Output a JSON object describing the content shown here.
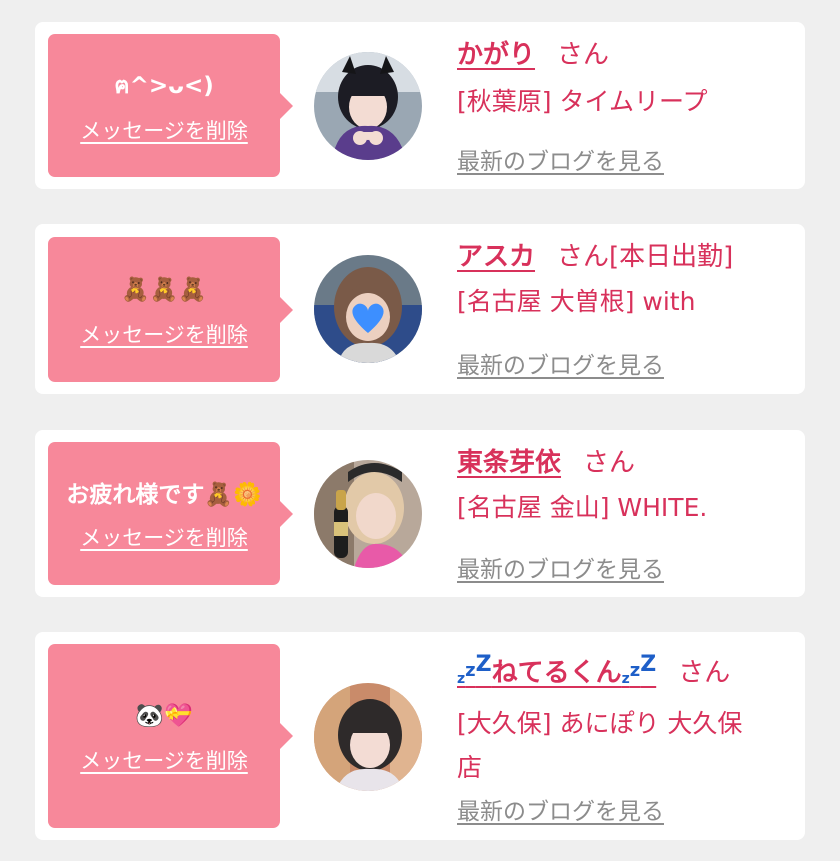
{
  "delete_label": "メッセージを削除",
  "blog_label": "最新のブログを見る",
  "honorific": "さん",
  "colors": {
    "page_bg": "#efefef",
    "card_bg": "#ffffff",
    "bubble_bg": "#f7889a",
    "accent_text": "#d8315b",
    "link_gray": "#8c8c8c"
  },
  "entries": [
    {
      "message": "ฅ^>ᴗ<)",
      "name": "かがり",
      "extra": "",
      "shop_lines": [
        "[秋葉原] タイムリープ"
      ]
    },
    {
      "message": "🧸🧸🧸",
      "name": "アスカ",
      "extra": "[本日出勤]",
      "shop_lines": [
        "[名古屋 大曽根] with"
      ]
    },
    {
      "message": "お疲れ様です🧸🌼",
      "name": "東条芽依",
      "extra": "",
      "shop_lines": [
        "[名古屋 金山] WHITE."
      ]
    },
    {
      "message": "🐼💝",
      "name": "ねてるくん",
      "name_prefix": "zzZ",
      "name_suffix": "zzZ",
      "extra": "",
      "shop_lines": [
        "[大久保] あにぽり 大久保",
        "店"
      ]
    }
  ]
}
